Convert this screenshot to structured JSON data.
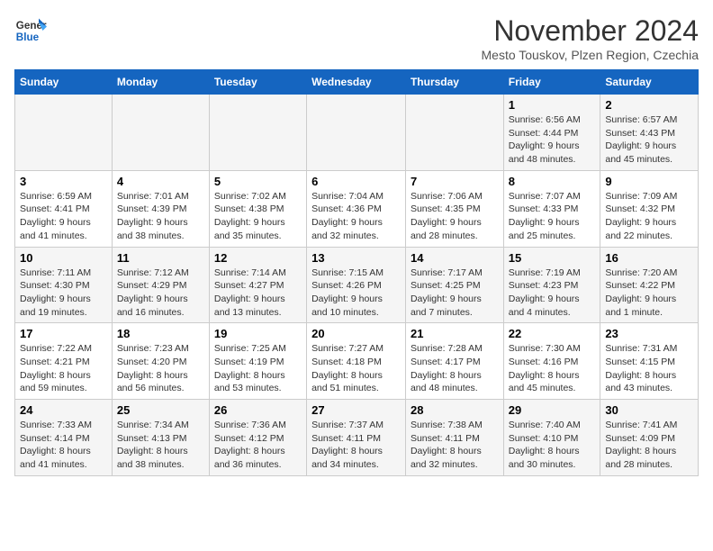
{
  "header": {
    "logo_line1": "General",
    "logo_line2": "Blue",
    "month": "November 2024",
    "location": "Mesto Touskov, Plzen Region, Czechia"
  },
  "days_of_week": [
    "Sunday",
    "Monday",
    "Tuesday",
    "Wednesday",
    "Thursday",
    "Friday",
    "Saturday"
  ],
  "weeks": [
    [
      {
        "day": "",
        "detail": ""
      },
      {
        "day": "",
        "detail": ""
      },
      {
        "day": "",
        "detail": ""
      },
      {
        "day": "",
        "detail": ""
      },
      {
        "day": "",
        "detail": ""
      },
      {
        "day": "1",
        "detail": "Sunrise: 6:56 AM\nSunset: 4:44 PM\nDaylight: 9 hours and 48 minutes."
      },
      {
        "day": "2",
        "detail": "Sunrise: 6:57 AM\nSunset: 4:43 PM\nDaylight: 9 hours and 45 minutes."
      }
    ],
    [
      {
        "day": "3",
        "detail": "Sunrise: 6:59 AM\nSunset: 4:41 PM\nDaylight: 9 hours and 41 minutes."
      },
      {
        "day": "4",
        "detail": "Sunrise: 7:01 AM\nSunset: 4:39 PM\nDaylight: 9 hours and 38 minutes."
      },
      {
        "day": "5",
        "detail": "Sunrise: 7:02 AM\nSunset: 4:38 PM\nDaylight: 9 hours and 35 minutes."
      },
      {
        "day": "6",
        "detail": "Sunrise: 7:04 AM\nSunset: 4:36 PM\nDaylight: 9 hours and 32 minutes."
      },
      {
        "day": "7",
        "detail": "Sunrise: 7:06 AM\nSunset: 4:35 PM\nDaylight: 9 hours and 28 minutes."
      },
      {
        "day": "8",
        "detail": "Sunrise: 7:07 AM\nSunset: 4:33 PM\nDaylight: 9 hours and 25 minutes."
      },
      {
        "day": "9",
        "detail": "Sunrise: 7:09 AM\nSunset: 4:32 PM\nDaylight: 9 hours and 22 minutes."
      }
    ],
    [
      {
        "day": "10",
        "detail": "Sunrise: 7:11 AM\nSunset: 4:30 PM\nDaylight: 9 hours and 19 minutes."
      },
      {
        "day": "11",
        "detail": "Sunrise: 7:12 AM\nSunset: 4:29 PM\nDaylight: 9 hours and 16 minutes."
      },
      {
        "day": "12",
        "detail": "Sunrise: 7:14 AM\nSunset: 4:27 PM\nDaylight: 9 hours and 13 minutes."
      },
      {
        "day": "13",
        "detail": "Sunrise: 7:15 AM\nSunset: 4:26 PM\nDaylight: 9 hours and 10 minutes."
      },
      {
        "day": "14",
        "detail": "Sunrise: 7:17 AM\nSunset: 4:25 PM\nDaylight: 9 hours and 7 minutes."
      },
      {
        "day": "15",
        "detail": "Sunrise: 7:19 AM\nSunset: 4:23 PM\nDaylight: 9 hours and 4 minutes."
      },
      {
        "day": "16",
        "detail": "Sunrise: 7:20 AM\nSunset: 4:22 PM\nDaylight: 9 hours and 1 minute."
      }
    ],
    [
      {
        "day": "17",
        "detail": "Sunrise: 7:22 AM\nSunset: 4:21 PM\nDaylight: 8 hours and 59 minutes."
      },
      {
        "day": "18",
        "detail": "Sunrise: 7:23 AM\nSunset: 4:20 PM\nDaylight: 8 hours and 56 minutes."
      },
      {
        "day": "19",
        "detail": "Sunrise: 7:25 AM\nSunset: 4:19 PM\nDaylight: 8 hours and 53 minutes."
      },
      {
        "day": "20",
        "detail": "Sunrise: 7:27 AM\nSunset: 4:18 PM\nDaylight: 8 hours and 51 minutes."
      },
      {
        "day": "21",
        "detail": "Sunrise: 7:28 AM\nSunset: 4:17 PM\nDaylight: 8 hours and 48 minutes."
      },
      {
        "day": "22",
        "detail": "Sunrise: 7:30 AM\nSunset: 4:16 PM\nDaylight: 8 hours and 45 minutes."
      },
      {
        "day": "23",
        "detail": "Sunrise: 7:31 AM\nSunset: 4:15 PM\nDaylight: 8 hours and 43 minutes."
      }
    ],
    [
      {
        "day": "24",
        "detail": "Sunrise: 7:33 AM\nSunset: 4:14 PM\nDaylight: 8 hours and 41 minutes."
      },
      {
        "day": "25",
        "detail": "Sunrise: 7:34 AM\nSunset: 4:13 PM\nDaylight: 8 hours and 38 minutes."
      },
      {
        "day": "26",
        "detail": "Sunrise: 7:36 AM\nSunset: 4:12 PM\nDaylight: 8 hours and 36 minutes."
      },
      {
        "day": "27",
        "detail": "Sunrise: 7:37 AM\nSunset: 4:11 PM\nDaylight: 8 hours and 34 minutes."
      },
      {
        "day": "28",
        "detail": "Sunrise: 7:38 AM\nSunset: 4:11 PM\nDaylight: 8 hours and 32 minutes."
      },
      {
        "day": "29",
        "detail": "Sunrise: 7:40 AM\nSunset: 4:10 PM\nDaylight: 8 hours and 30 minutes."
      },
      {
        "day": "30",
        "detail": "Sunrise: 7:41 AM\nSunset: 4:09 PM\nDaylight: 8 hours and 28 minutes."
      }
    ]
  ]
}
